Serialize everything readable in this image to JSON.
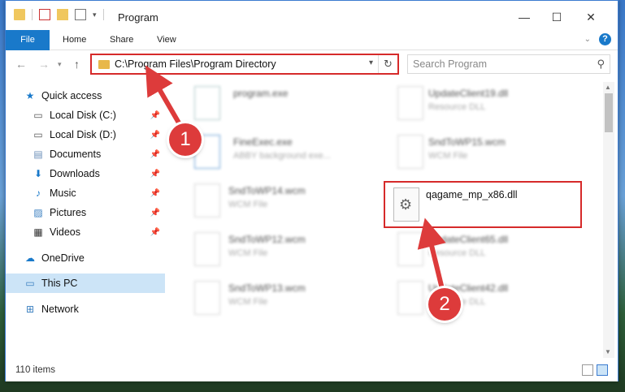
{
  "window": {
    "title": "Program"
  },
  "ribbon": {
    "tabs": [
      {
        "label": "File"
      },
      {
        "label": "Home"
      },
      {
        "label": "Share"
      },
      {
        "label": "View"
      }
    ]
  },
  "address": {
    "path": "C:\\Program Files\\Program Directory"
  },
  "search": {
    "placeholder": "Search Program"
  },
  "sidebar": {
    "items": [
      {
        "label": "Quick access",
        "icon": "star-icon"
      },
      {
        "label": "Local Disk (C:)",
        "icon": "drive-icon"
      },
      {
        "label": "Local Disk (D:)",
        "icon": "drive-icon"
      },
      {
        "label": "Documents",
        "icon": "documents-icon"
      },
      {
        "label": "Downloads",
        "icon": "download-icon"
      },
      {
        "label": "Music",
        "icon": "music-icon"
      },
      {
        "label": "Pictures",
        "icon": "pictures-icon"
      },
      {
        "label": "Videos",
        "icon": "video-icon"
      },
      {
        "label": "OneDrive",
        "icon": "cloud-icon"
      },
      {
        "label": "This PC",
        "icon": "computer-icon"
      },
      {
        "label": "Network",
        "icon": "network-icon"
      }
    ]
  },
  "files": [
    {
      "name": "program.exe",
      "type": ""
    },
    {
      "name": "UpdateClient19.dll",
      "type": "Resource DLL"
    },
    {
      "name": "FineExec.exe",
      "type": "ABBY background exe..."
    },
    {
      "name": "SndToWP15.wcm",
      "type": "WCM File"
    },
    {
      "name": "SndToWP14.wcm",
      "type": "WCM File"
    },
    {
      "name": "qagame_mp_x86.dll",
      "type": ""
    },
    {
      "name": "SndToWP12.wcm",
      "type": "WCM File"
    },
    {
      "name": "UpdateClient65.dll",
      "type": "Resource DLL"
    },
    {
      "name": "SndToWP13.wcm",
      "type": "WCM File"
    },
    {
      "name": "UpdateClient42.dll",
      "type": "Resource DLL"
    }
  ],
  "status": {
    "items": "110 items"
  },
  "callouts": {
    "one": "1",
    "two": "2"
  },
  "colors": {
    "accent": "#1979ca",
    "highlight": "#d62a2a",
    "callout": "#dd3b3b"
  }
}
